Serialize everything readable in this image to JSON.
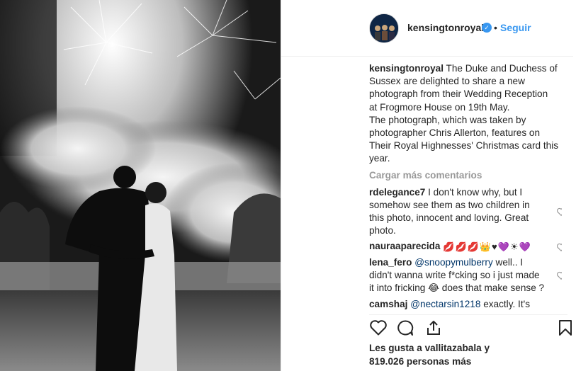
{
  "post": {
    "username": "kensingtonroyal",
    "verified_icon": "verified-badge-icon",
    "follow_label": "Seguir",
    "separator": "•"
  },
  "caption": {
    "username": "kensingtonroyal",
    "lines": [
      "The Duke and Duchess of",
      "Sussex are delighted to share a new",
      "photograph from their Wedding Reception",
      "at Frogmore House on 19th May.",
      "The photograph, which was taken by",
      "photographer Chris Allerton, features on",
      "Their Royal Highnesses' Christmas card this",
      "year."
    ]
  },
  "load_more": "Cargar más comentarios",
  "comments": [
    {
      "username": "rdelegance7",
      "text": "I don't know why, but I somehow see them as two children in this photo, innocent and loving. Great photo."
    },
    {
      "username": "nauraaparecida",
      "emojis": [
        "💋",
        "💋",
        "💋",
        "👑",
        "♥",
        "💜",
        "☀",
        "💜"
      ]
    },
    {
      "username": "lena_fero",
      "mention": "@snoopymulberry",
      "text_before_emoji": "well.. I didn't wanna write f*cking so i just made it into fricking",
      "emoji": "😂",
      "text_after_emoji": "does that make sense ?"
    },
    {
      "username": "camshaj",
      "mention": "@nectarsin1218",
      "text": "exactly. It's"
    }
  ],
  "likes": {
    "line1": "Les gusta a vallitazabala y",
    "line2": "819.026 personas más"
  },
  "icons": {
    "like": "heart-outline-icon",
    "comment": "comment-bubble-icon",
    "share": "share-icon",
    "save": "bookmark-icon"
  },
  "colors": {
    "link_blue": "#3897f0",
    "muted": "#999999",
    "text": "#262626",
    "border": "#efefef"
  }
}
